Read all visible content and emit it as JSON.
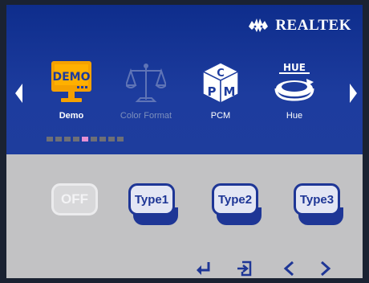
{
  "header": {
    "brand": "REALTEK"
  },
  "menu": {
    "items": [
      {
        "label": "Demo",
        "icon": "demo-icon",
        "badge": "DEMO",
        "selected": true
      },
      {
        "label": "Color Format",
        "icon": "scale-icon",
        "disabled": true
      },
      {
        "label": "PCM",
        "icon": "pcm-cube-icon",
        "letters": {
          "top": "C",
          "left": "P",
          "right": "M"
        }
      },
      {
        "label": "Hue",
        "icon": "hue-icon",
        "badge": "HUE"
      }
    ],
    "page_indicator": {
      "total": 9,
      "active_index": 4
    }
  },
  "options": [
    {
      "label": "OFF",
      "state": "disabled"
    },
    {
      "label": "Type1",
      "state": "enabled"
    },
    {
      "label": "Type2",
      "state": "enabled"
    },
    {
      "label": "Type3",
      "state": "enabled"
    }
  ],
  "nav_hints": [
    "enter-icon",
    "exit-icon",
    "left-arrow-icon",
    "right-arrow-icon"
  ],
  "colors": {
    "panel_blue": "#1d3c9e",
    "option_blue": "#1e3696",
    "highlight_orange": "#f5a100",
    "indicator_active": "#e58fd2",
    "background_gray": "#c2c2c4"
  }
}
